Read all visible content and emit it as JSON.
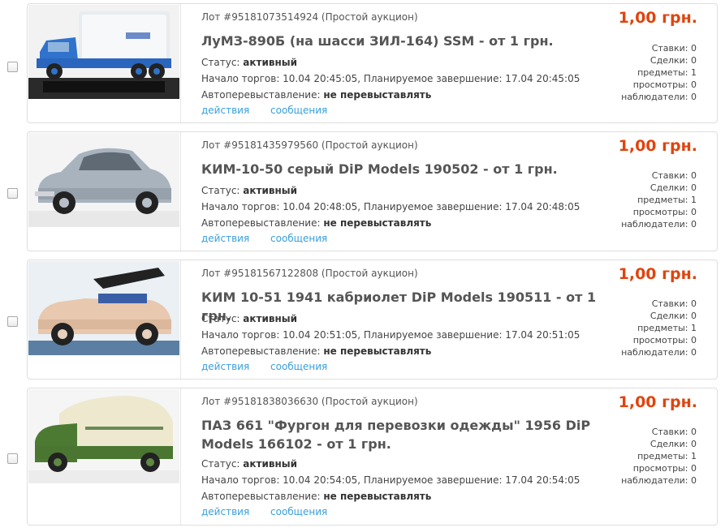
{
  "labels": {
    "status_prefix": "Статус: ",
    "autorelist_prefix": "Автоперевыставление: ",
    "actions_link": "действия",
    "messages_link": "сообщения"
  },
  "lots": [
    {
      "lot_line": "Лот #95181073514924 (Простой аукцион)",
      "title": "ЛуМЗ-890Б (на шасси ЗИЛ-164) SSM - от 1 грн.",
      "price": "1,00 грн.",
      "status": "активный",
      "times": "Начало торгов: 10.04 20:45:05, Планируемое завершение: 17.04 20:45:05",
      "autorelist": "не перевыставлять",
      "stats": [
        "Ставки: 0",
        "Сделки: 0",
        "предметы: 1",
        "просмотры: 0",
        "наблюдатели: 0"
      ],
      "image": "blue-van-truck-model"
    },
    {
      "lot_line": "Лот #95181435979560 (Простой аукцион)",
      "title": "КИМ-10-50 серый DiP Models 190502 - от 1 грн.",
      "price": "1,00 грн.",
      "status": "активный",
      "times": "Начало торгов: 10.04 20:48:05, Планируемое завершение: 17.04 20:48:05",
      "autorelist": "не перевыставлять",
      "stats": [
        "Ставки: 0",
        "Сделки: 0",
        "предметы: 1",
        "просмотры: 0",
        "наблюдатели: 0"
      ],
      "image": "grey-sedan-model"
    },
    {
      "lot_line": "Лот #95181567122808 (Простой аукцион)",
      "title": "КИМ 10-51 1941 кабриолет DiP Models 190511 - от 1 грн.",
      "price": "1,00 грн.",
      "status": "активный",
      "times": "Начало торгов: 10.04 20:51:05, Планируемое завершение: 17.04 20:51:05",
      "autorelist": "не перевыставлять",
      "stats": [
        "Ставки: 0",
        "Сделки: 0",
        "предметы: 1",
        "просмотры: 0",
        "наблюдатели: 0"
      ],
      "image": "beige-convertible-model"
    },
    {
      "lot_line": "Лот #95181838036630 (Простой аукцион)",
      "title": "ПАЗ 661 \"Фургон для перевозки одежды\" 1956 DiP Models 166102 - от 1 грн.",
      "price": "1,00 грн.",
      "status": "активный",
      "times": "Начало торгов: 10.04 20:54:05, Планируемое завершение: 17.04 20:54:05",
      "autorelist": "не перевыставлять",
      "stats": [
        "Ставки: 0",
        "Сделки: 0",
        "предметы: 1",
        "просмотры: 0",
        "наблюдатели: 0"
      ],
      "image": "green-cream-van-model"
    }
  ]
}
